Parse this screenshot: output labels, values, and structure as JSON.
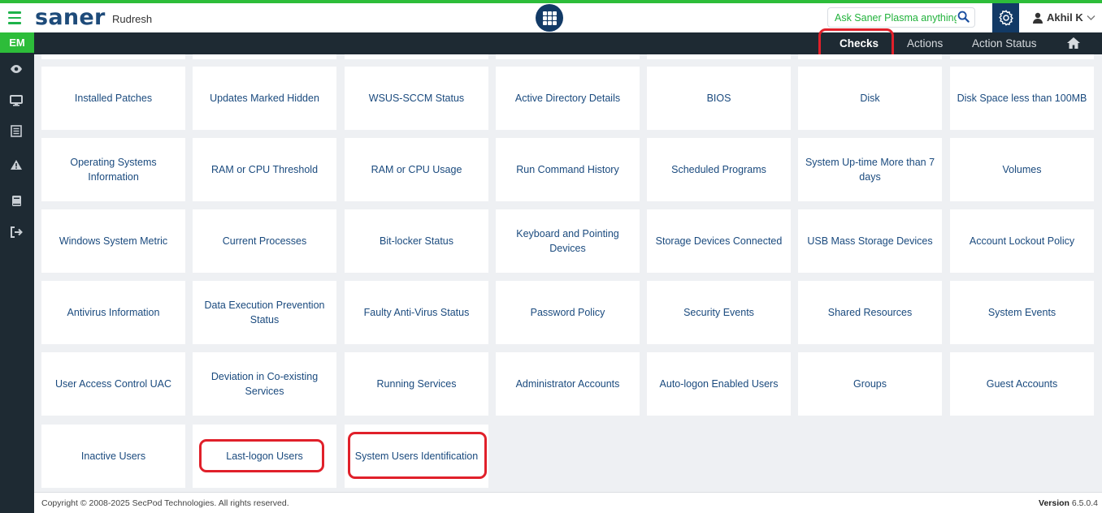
{
  "header": {
    "logo": "saner",
    "tenant": "Rudresh",
    "ask_placeholder": "Ask Saner Plasma anything !",
    "user": "Akhil K"
  },
  "sidebar": {
    "badge": "EM",
    "icons": [
      "eye-icon",
      "monitor-icon",
      "list-icon",
      "warning-icon",
      "book-icon",
      "logout-icon"
    ]
  },
  "nav": {
    "checks": "Checks",
    "actions": "Actions",
    "action_status": "Action Status"
  },
  "cards": [
    [
      "Installed Patches",
      "Updates Marked Hidden",
      "WSUS-SCCM Status",
      "Active Directory Details",
      "BIOS",
      "Disk",
      "Disk Space less than 100MB"
    ],
    [
      "Operating Systems Information",
      "RAM or CPU Threshold",
      "RAM or CPU Usage",
      "Run Command History",
      "Scheduled Programs",
      "System Up-time More than 7 days",
      "Volumes"
    ],
    [
      "Windows System Metric",
      "Current Processes",
      "Bit-locker Status",
      "Keyboard and Pointing Devices",
      "Storage Devices Connected",
      "USB Mass Storage Devices",
      "Account Lockout Policy"
    ],
    [
      "Antivirus Information",
      "Data Execution Prevention Status",
      "Faulty Anti-Virus Status",
      "Password Policy",
      "Security Events",
      "Shared Resources",
      "System Events"
    ],
    [
      "User Access Control UAC",
      "Deviation in Co-existing Services",
      "Running Services",
      "Administrator Accounts",
      "Auto-logon Enabled Users",
      "Groups",
      "Guest Accounts"
    ],
    [
      "Inactive Users",
      "Last-logon Users",
      "System Users Identification"
    ]
  ],
  "footer": {
    "copyright": "Copyright © 2008-2025 SecPod Technologies. All rights reserved.",
    "version_label": "Version",
    "version_value": "6.5.0.4"
  },
  "colors": {
    "accent_green": "#2dbd3a",
    "nav_dark": "#1e2a33",
    "brand_blue": "#123a66",
    "card_text": "#1a4a7e",
    "highlight_red": "#e0202a"
  }
}
